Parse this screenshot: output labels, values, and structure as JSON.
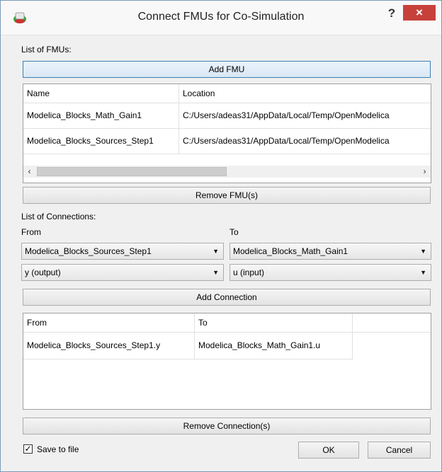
{
  "window": {
    "title": "Connect FMUs for Co-Simulation",
    "help_label": "?",
    "close_label": "×"
  },
  "fmus": {
    "section_label": "List of FMUs:",
    "add_label": "Add FMU",
    "columns": [
      "Name",
      "Location"
    ],
    "rows": [
      {
        "name": "Modelica_Blocks_Math_Gain1",
        "location": "C:/Users/adeas31/AppData/Local/Temp/OpenModelica"
      },
      {
        "name": "Modelica_Blocks_Sources_Step1",
        "location": "C:/Users/adeas31/AppData/Local/Temp/OpenModelica"
      }
    ],
    "scroll_left": "‹",
    "scroll_right": "›",
    "remove_label": "Remove FMU(s)"
  },
  "connections": {
    "section_label": "List of Connections:",
    "from_label": "From",
    "to_label": "To",
    "from_fmu": "Modelica_Blocks_Sources_Step1",
    "to_fmu": "Modelica_Blocks_Math_Gain1",
    "from_var": "y (output)",
    "to_var": "u (input)",
    "dropdown_arrow": "▼",
    "add_label": "Add Connection",
    "columns": [
      "From",
      "To"
    ],
    "rows": [
      {
        "from": "Modelica_Blocks_Sources_Step1.y",
        "to": "Modelica_Blocks_Math_Gain1.u"
      }
    ],
    "remove_label": "Remove Connection(s)"
  },
  "footer": {
    "save_checked": true,
    "check_mark": "✓",
    "save_label": "Save to file",
    "ok_label": "OK",
    "cancel_label": "Cancel"
  }
}
